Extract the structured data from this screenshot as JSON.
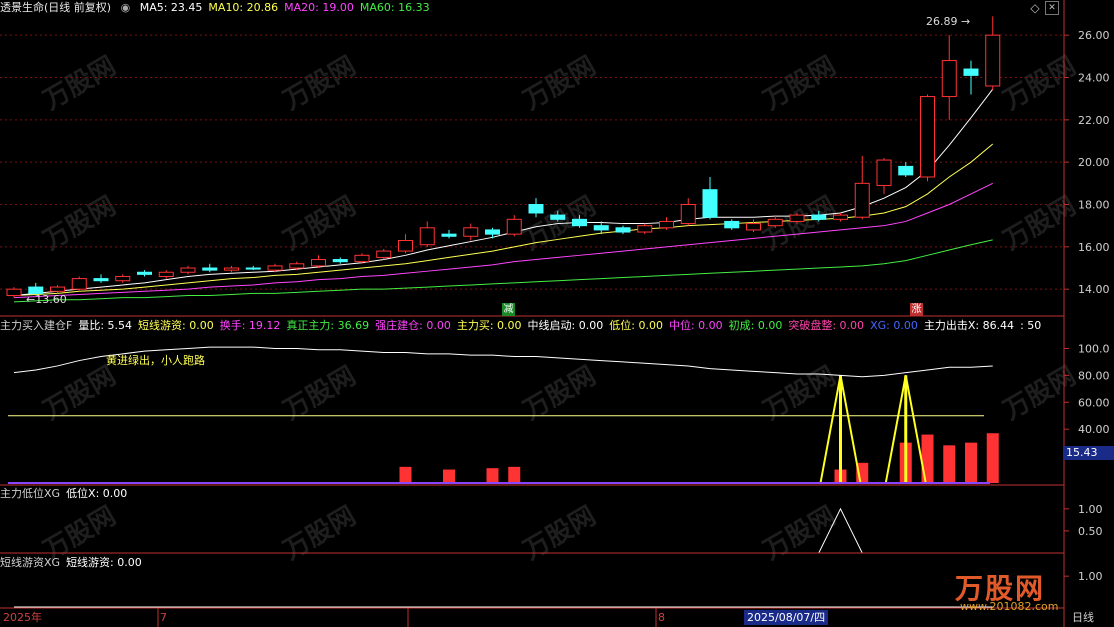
{
  "title": "透景生命",
  "period": "(日线 前复权)",
  "header_panel1": [
    {
      "label": "MA5: 23.45",
      "color": "#ffffff"
    },
    {
      "label": "MA10: 20.86",
      "color": "#ffff55"
    },
    {
      "label": "MA20: 19.00",
      "color": "#ff44ff"
    },
    {
      "label": "MA60: 16.33",
      "color": "#44ee44"
    }
  ],
  "header_panel2": [
    {
      "label": "主力买入建仓F",
      "color": "#d0d0d0"
    },
    {
      "label": "量比: 5.54",
      "color": "#ffffff"
    },
    {
      "label": "短线游资: 0.00",
      "color": "#ffff55"
    },
    {
      "label": "换手: 19.12",
      "color": "#ff44ff"
    },
    {
      "label": "真正主力: 36.69",
      "color": "#44ee44"
    },
    {
      "label": "强庄建仓: 0.00",
      "color": "#ff44ff"
    },
    {
      "label": "主力买: 0.00",
      "color": "#ffff55"
    },
    {
      "label": "中线启动: 0.00",
      "color": "#ffffff"
    },
    {
      "label": "低位: 0.00",
      "color": "#ffff55"
    },
    {
      "label": "中位: 0.00",
      "color": "#ff44ff"
    },
    {
      "label": "初成: 0.00",
      "color": "#44ee44"
    },
    {
      "label": "突破盘整: 0.00",
      "color": "#ff44aa"
    },
    {
      "label": "XG: 0.00",
      "color": "#4466ff"
    },
    {
      "label": "主力出击X: 86.44",
      "color": "#ffffff"
    },
    {
      "label": ": 50",
      "color": "#ffffff"
    }
  ],
  "header_panel3": [
    {
      "label": "主力低位XG",
      "color": "#d0d0d0"
    },
    {
      "label": "低位X: 0.00",
      "color": "#ffffff"
    }
  ],
  "header_panel4": [
    {
      "label": "短线游资XG",
      "color": "#d0d0d0"
    },
    {
      "label": "短线游资: 0.00",
      "color": "#ffffff"
    }
  ],
  "annotation_text": "黄进绿出，小人跑路",
  "high_label": "26.89",
  "low_label": "13.60",
  "marker_down": "减",
  "marker_up": "涨",
  "panel2_value_box": "15.43",
  "x_axis_labels": [
    "2025年",
    "7",
    "8",
    "2025/08/07/四",
    "日线"
  ],
  "watermark_logo": "万股网",
  "watermark_url": "www.201082.com",
  "colors": {
    "up": "#ff3333",
    "down": "#44ffff",
    "ma5": "#ffffff",
    "ma10": "#ffff55",
    "ma20": "#ff44ff",
    "ma60": "#44ee44",
    "grid": "#7a1010",
    "separator": "#c03030"
  },
  "chart_data": [
    {
      "type": "candlestick",
      "title": "透景生命 (日线 前复权)",
      "y_ticks": [
        "26.00",
        "24.00",
        "22.00",
        "20.00",
        "18.00",
        "16.00",
        "14.00"
      ],
      "ylim": [
        13.3,
        27.0
      ],
      "candles": [
        {
          "o": 13.7,
          "c": 14.0,
          "h": 14.1,
          "l": 13.6
        },
        {
          "o": 14.1,
          "c": 13.8,
          "h": 14.3,
          "l": 13.7
        },
        {
          "o": 13.9,
          "c": 14.1,
          "h": 14.2,
          "l": 13.8
        },
        {
          "o": 14.0,
          "c": 14.5,
          "h": 14.6,
          "l": 13.9
        },
        {
          "o": 14.5,
          "c": 14.4,
          "h": 14.7,
          "l": 14.3
        },
        {
          "o": 14.4,
          "c": 14.6,
          "h": 14.7,
          "l": 14.3
        },
        {
          "o": 14.8,
          "c": 14.7,
          "h": 14.9,
          "l": 14.6
        },
        {
          "o": 14.6,
          "c": 14.8,
          "h": 14.9,
          "l": 14.5
        },
        {
          "o": 14.8,
          "c": 15.0,
          "h": 15.1,
          "l": 14.7
        },
        {
          "o": 15.0,
          "c": 14.9,
          "h": 15.2,
          "l": 14.8
        },
        {
          "o": 14.9,
          "c": 15.0,
          "h": 15.1,
          "l": 14.8
        },
        {
          "o": 15.0,
          "c": 14.95,
          "h": 15.1,
          "l": 14.9
        },
        {
          "o": 14.9,
          "c": 15.1,
          "h": 15.2,
          "l": 14.8
        },
        {
          "o": 15.0,
          "c": 15.2,
          "h": 15.3,
          "l": 14.9
        },
        {
          "o": 15.1,
          "c": 15.4,
          "h": 15.6,
          "l": 15.0
        },
        {
          "o": 15.4,
          "c": 15.3,
          "h": 15.5,
          "l": 15.2
        },
        {
          "o": 15.3,
          "c": 15.6,
          "h": 15.7,
          "l": 15.2
        },
        {
          "o": 15.5,
          "c": 15.8,
          "h": 15.9,
          "l": 15.4
        },
        {
          "o": 15.8,
          "c": 16.3,
          "h": 16.6,
          "l": 15.7
        },
        {
          "o": 16.1,
          "c": 16.9,
          "h": 17.2,
          "l": 16.0
        },
        {
          "o": 16.6,
          "c": 16.5,
          "h": 16.8,
          "l": 16.4
        },
        {
          "o": 16.5,
          "c": 16.9,
          "h": 17.1,
          "l": 16.3
        },
        {
          "o": 16.8,
          "c": 16.6,
          "h": 16.9,
          "l": 16.4
        },
        {
          "o": 16.6,
          "c": 17.3,
          "h": 17.5,
          "l": 16.5
        },
        {
          "o": 18.0,
          "c": 17.6,
          "h": 18.3,
          "l": 17.4
        },
        {
          "o": 17.5,
          "c": 17.3,
          "h": 17.7,
          "l": 17.2
        },
        {
          "o": 17.3,
          "c": 17.0,
          "h": 17.5,
          "l": 16.9
        },
        {
          "o": 17.0,
          "c": 16.8,
          "h": 17.2,
          "l": 16.6
        },
        {
          "o": 16.9,
          "c": 16.7,
          "h": 17.0,
          "l": 16.6
        },
        {
          "o": 16.7,
          "c": 17.0,
          "h": 17.1,
          "l": 16.6
        },
        {
          "o": 16.9,
          "c": 17.2,
          "h": 17.4,
          "l": 16.8
        },
        {
          "o": 17.1,
          "c": 18.0,
          "h": 18.3,
          "l": 17.0
        },
        {
          "o": 18.7,
          "c": 17.4,
          "h": 19.3,
          "l": 17.3
        },
        {
          "o": 17.2,
          "c": 16.9,
          "h": 17.3,
          "l": 16.8
        },
        {
          "o": 16.8,
          "c": 17.1,
          "h": 17.3,
          "l": 16.7
        },
        {
          "o": 17.0,
          "c": 17.3,
          "h": 17.5,
          "l": 16.9
        },
        {
          "o": 17.2,
          "c": 17.5,
          "h": 17.6,
          "l": 17.1
        },
        {
          "o": 17.5,
          "c": 17.3,
          "h": 17.7,
          "l": 17.2
        },
        {
          "o": 17.3,
          "c": 17.5,
          "h": 17.6,
          "l": 17.2
        },
        {
          "o": 17.4,
          "c": 19.0,
          "h": 20.3,
          "l": 17.3
        },
        {
          "o": 18.9,
          "c": 20.1,
          "h": 20.2,
          "l": 18.5
        },
        {
          "o": 19.8,
          "c": 19.4,
          "h": 20.0,
          "l": 19.3
        },
        {
          "o": 19.3,
          "c": 23.1,
          "h": 23.2,
          "l": 19.1
        },
        {
          "o": 23.1,
          "c": 24.8,
          "h": 26.0,
          "l": 22.0
        },
        {
          "o": 24.4,
          "c": 24.1,
          "h": 24.8,
          "l": 23.2
        },
        {
          "o": 23.6,
          "c": 26.0,
          "h": 26.89,
          "l": 23.4
        }
      ],
      "ma5": [
        13.7,
        13.8,
        13.9,
        14.0,
        14.1,
        14.2,
        14.3,
        14.45,
        14.6,
        14.7,
        14.75,
        14.8,
        14.85,
        14.95,
        15.05,
        15.15,
        15.25,
        15.4,
        15.6,
        15.85,
        16.05,
        16.25,
        16.45,
        16.7,
        16.95,
        17.1,
        17.15,
        17.15,
        17.1,
        17.1,
        17.15,
        17.3,
        17.4,
        17.4,
        17.4,
        17.45,
        17.45,
        17.5,
        17.6,
        17.9,
        18.3,
        18.8,
        19.6,
        20.8,
        22.1,
        23.45
      ],
      "ma10": [
        13.7,
        13.75,
        13.8,
        13.9,
        13.95,
        14.0,
        14.1,
        14.2,
        14.3,
        14.4,
        14.5,
        14.55,
        14.65,
        14.7,
        14.8,
        14.9,
        15.0,
        15.1,
        15.2,
        15.35,
        15.5,
        15.65,
        15.8,
        16.0,
        16.2,
        16.35,
        16.5,
        16.65,
        16.75,
        16.85,
        16.9,
        17.0,
        17.05,
        17.1,
        17.15,
        17.2,
        17.25,
        17.3,
        17.35,
        17.45,
        17.6,
        17.9,
        18.5,
        19.3,
        20.0,
        20.86
      ],
      "ma20": [
        13.6,
        13.65,
        13.7,
        13.75,
        13.8,
        13.85,
        13.9,
        13.95,
        14.0,
        14.1,
        14.15,
        14.2,
        14.3,
        14.35,
        14.45,
        14.5,
        14.6,
        14.65,
        14.75,
        14.85,
        14.95,
        15.05,
        15.15,
        15.3,
        15.4,
        15.5,
        15.6,
        15.7,
        15.8,
        15.9,
        16.0,
        16.1,
        16.2,
        16.3,
        16.4,
        16.5,
        16.6,
        16.7,
        16.8,
        16.9,
        17.0,
        17.2,
        17.6,
        18.0,
        18.5,
        19.0
      ],
      "ma60": [
        13.4,
        13.45,
        13.5,
        13.5,
        13.55,
        13.6,
        13.6,
        13.65,
        13.7,
        13.7,
        13.75,
        13.8,
        13.8,
        13.85,
        13.9,
        13.95,
        14.0,
        14.0,
        14.05,
        14.1,
        14.15,
        14.2,
        14.25,
        14.3,
        14.35,
        14.4,
        14.45,
        14.5,
        14.55,
        14.6,
        14.65,
        14.7,
        14.75,
        14.8,
        14.85,
        14.9,
        14.95,
        15.0,
        15.05,
        15.1,
        15.2,
        15.35,
        15.6,
        15.85,
        16.1,
        16.33
      ]
    },
    {
      "type": "line",
      "title": "主力买入建仓F",
      "y_ticks": [
        "100.0",
        "80.00",
        "60.00",
        "40.00"
      ],
      "ylim": [
        0,
        110
      ],
      "reference_line": 50,
      "line_values": [
        82,
        84,
        87,
        91,
        94,
        96,
        98,
        99,
        100,
        101,
        101,
        101,
        100,
        100,
        99,
        99,
        98,
        97,
        97,
        96,
        96,
        95,
        95,
        94,
        94,
        93,
        92,
        91,
        90,
        89,
        88,
        87,
        85,
        84,
        83,
        82,
        81,
        81,
        80,
        79,
        80,
        82,
        84,
        86,
        86,
        87,
        86.44
      ],
      "bars": [
        {
          "i": 18,
          "v": 12
        },
        {
          "i": 20,
          "v": 10
        },
        {
          "i": 22,
          "v": 11
        },
        {
          "i": 23,
          "v": 12
        },
        {
          "i": 38,
          "v": 10
        },
        {
          "i": 39,
          "v": 15
        },
        {
          "i": 41,
          "v": 30
        },
        {
          "i": 42,
          "v": 36
        },
        {
          "i": 43,
          "v": 28
        },
        {
          "i": 44,
          "v": 30
        },
        {
          "i": 45,
          "v": 37
        }
      ],
      "spikes": [
        {
          "i": 38,
          "v": 80
        },
        {
          "i": 41,
          "v": 80
        }
      ]
    },
    {
      "type": "line",
      "title": "主力低位XG",
      "y_ticks": [
        "1.00",
        "0.50"
      ],
      "ylim": [
        0,
        1.2
      ],
      "values": [
        0,
        0,
        0,
        0,
        0,
        0,
        0,
        0,
        0,
        0,
        0,
        0,
        0,
        0,
        0,
        0,
        0,
        0,
        0,
        0,
        0,
        0,
        0,
        0,
        0,
        0,
        0,
        0,
        0,
        0,
        0,
        0,
        0,
        0,
        0,
        0,
        0,
        0,
        1,
        0,
        0,
        0,
        0,
        0,
        0,
        0
      ]
    },
    {
      "type": "line",
      "title": "短线游资XG",
      "y_ticks": [
        "1.00"
      ],
      "ylim": [
        0,
        1.2
      ],
      "values": [
        0,
        0,
        0,
        0,
        0,
        0,
        0,
        0,
        0,
        0,
        0,
        0,
        0,
        0,
        0,
        0,
        0,
        0,
        0,
        0,
        0,
        0,
        0,
        0,
        0,
        0,
        0,
        0,
        0,
        0,
        0,
        0,
        0,
        0,
        0,
        0,
        0,
        0,
        0,
        0,
        0,
        0,
        0,
        0,
        0,
        0
      ]
    }
  ]
}
